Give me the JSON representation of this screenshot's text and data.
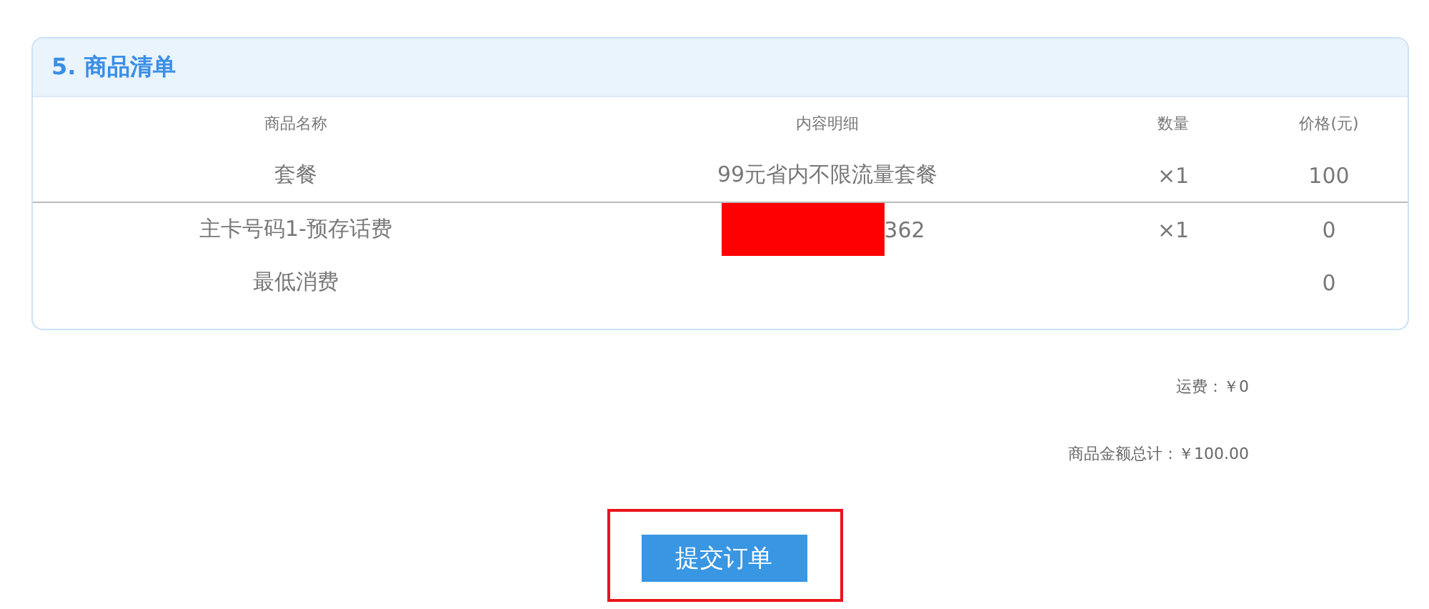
{
  "section": {
    "title": "5. 商品清单"
  },
  "table": {
    "columns": [
      "商品名称",
      "内容明细",
      "数量",
      "价格(元)"
    ],
    "rows": [
      {
        "name": "套餐",
        "detail": "99元省内不限流量套餐",
        "quantity": "×1",
        "price": "100",
        "divider_after": true
      },
      {
        "name": "主卡号码1-预存话费",
        "detail": "362",
        "detail_redacted": true,
        "quantity": "×1",
        "price": "0"
      },
      {
        "name": "最低消费",
        "price": "0"
      }
    ]
  },
  "shipping": "运费：￥0",
  "total": "商品金额总计：￥100.00",
  "submit_button": {
    "label": "提交订单",
    "highlighted": true
  }
}
